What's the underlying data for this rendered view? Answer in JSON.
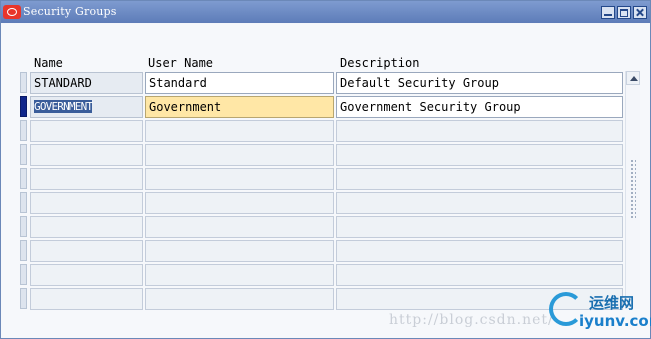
{
  "window": {
    "title": "Security Groups"
  },
  "columns": {
    "name": "Name",
    "user_name": "User Name",
    "description": "Description"
  },
  "rows": [
    {
      "name": "STANDARD",
      "user_name": "Standard",
      "description": "Default Security Group"
    },
    {
      "name": "GOVERNMENT",
      "user_name": "Government",
      "description": "Government Security Group"
    },
    {
      "name": "",
      "user_name": "",
      "description": ""
    },
    {
      "name": "",
      "user_name": "",
      "description": ""
    },
    {
      "name": "",
      "user_name": "",
      "description": ""
    },
    {
      "name": "",
      "user_name": "",
      "description": ""
    },
    {
      "name": "",
      "user_name": "",
      "description": ""
    },
    {
      "name": "",
      "user_name": "",
      "description": ""
    },
    {
      "name": "",
      "user_name": "",
      "description": ""
    },
    {
      "name": "",
      "user_name": "",
      "description": ""
    }
  ],
  "watermark": {
    "url": "http://blog.csdn.net/",
    "logo_cn": "运维网",
    "logo_en": "iyunv.com"
  },
  "colors": {
    "titlebar": "#6e8cc4",
    "current_field": "#ffe7a6",
    "record_indicator": "#10268a"
  }
}
